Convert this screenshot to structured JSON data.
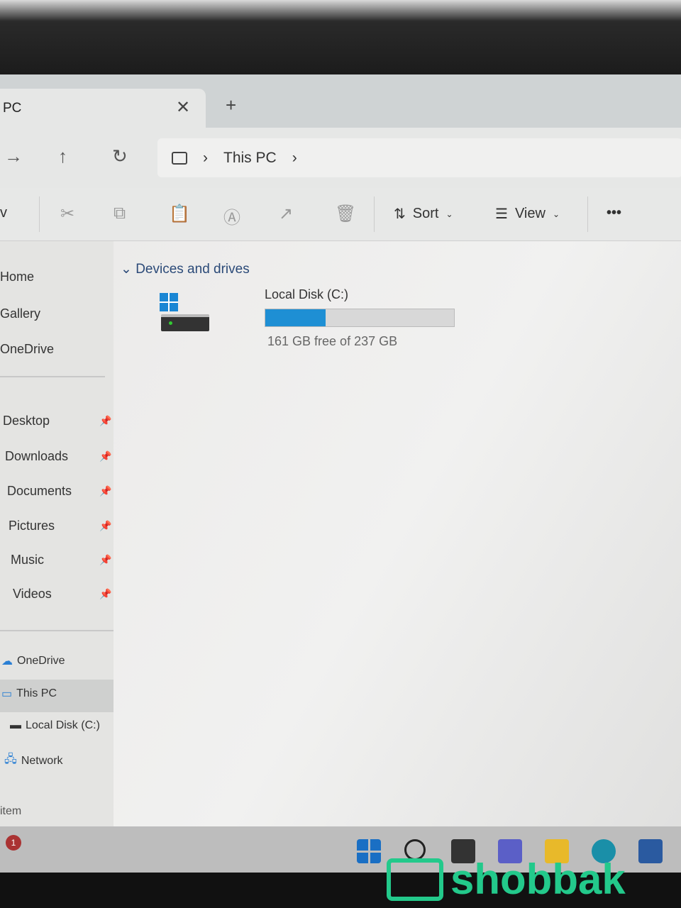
{
  "window": {
    "tab_title": "PC",
    "close_tab": "✕",
    "new_tab": "+"
  },
  "address": {
    "back": "→",
    "up": "↑",
    "refresh": "↻",
    "breadcrumb": [
      "This PC"
    ],
    "sep": "›"
  },
  "toolbar": {
    "sort_label": "Sort",
    "view_label": "View",
    "more": "•••",
    "new_label": "v"
  },
  "sidebar": {
    "top": [
      {
        "label": "Home"
      },
      {
        "label": "Gallery"
      },
      {
        "label": "OneDrive"
      }
    ],
    "pinned": [
      {
        "label": "Desktop"
      },
      {
        "label": "Downloads"
      },
      {
        "label": "Documents"
      },
      {
        "label": "Pictures"
      },
      {
        "label": "Music"
      },
      {
        "label": "Videos"
      }
    ],
    "tree": [
      {
        "label": "OneDrive"
      },
      {
        "label": "This PC",
        "selected": true
      },
      {
        "label": "Local Disk (C:)"
      },
      {
        "label": "Network"
      }
    ]
  },
  "content": {
    "section": "Devices and drives",
    "drives": [
      {
        "name": "Local Disk (C:)",
        "usage": "161 GB free of 237 GB",
        "used_fraction": 0.32,
        "bar_color": "#1e8fd4"
      }
    ]
  },
  "status": {
    "text": "item"
  },
  "taskbar": {
    "badge": "1",
    "icons": [
      "windows-start",
      "search",
      "task-view",
      "teams",
      "file-explorer",
      "edge",
      "store"
    ]
  },
  "watermark": {
    "text": "shobbak",
    "color": "#23c98b"
  }
}
